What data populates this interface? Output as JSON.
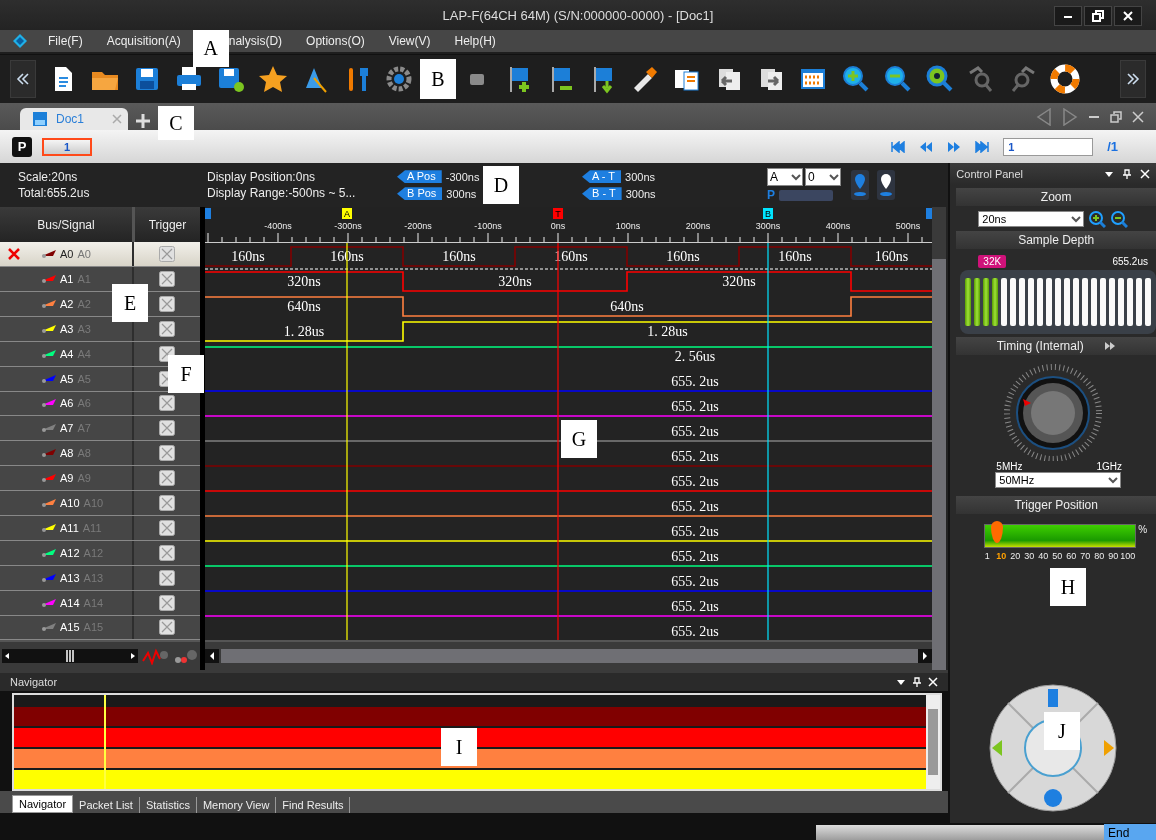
{
  "window": {
    "title": "LAP-F(64CH 64M) (S/N:000000-0000) - [Doc1]"
  },
  "menu": [
    {
      "label": "File(F)"
    },
    {
      "label": "Acquisition(A)"
    },
    {
      "label": "nalysis(D)"
    },
    {
      "label": "Options(O)"
    },
    {
      "label": "View(V)"
    },
    {
      "label": "Help(H)"
    }
  ],
  "doc_tabs": [
    {
      "label": "Doc1",
      "selected": true
    }
  ],
  "page_bar": {
    "p_button": "P",
    "tabs": [
      {
        "label": "1",
        "selected": true
      }
    ],
    "page_input": "1",
    "page_total": "/1"
  },
  "info": {
    "scale": "Scale:20ns",
    "total": "Total:655.2us",
    "display_position": "Display Position:0ns",
    "display_range": "Display Range:-500ns ~ 5...",
    "measurements": [
      {
        "tag": "A Pos",
        "value": "-300ns"
      },
      {
        "tag": "B Pos",
        "value": "300ns"
      },
      {
        "tag": "A - T",
        "value": "300ns"
      },
      {
        "tag": "B - T",
        "value": "300ns"
      }
    ],
    "cursor_select": "A",
    "value_select": "0",
    "p_label": "P"
  },
  "signal_list": {
    "columns": [
      "Bus/Signal",
      "Trigger"
    ],
    "signals": [
      {
        "name": "A0",
        "alias": "A0",
        "color": "#800000",
        "selected": true,
        "labels": [
          "160ns",
          "160ns",
          "160ns",
          "160ns",
          "160ns",
          "160ns",
          "160ns"
        ]
      },
      {
        "name": "A1",
        "alias": "A1",
        "color": "#ff0000",
        "selected": false,
        "labels": [
          "320ns",
          "320ns",
          "320ns"
        ]
      },
      {
        "name": "A2",
        "alias": "A2",
        "color": "#ff8040",
        "selected": false,
        "labels": [
          "640ns",
          "640ns"
        ]
      },
      {
        "name": "A3",
        "alias": "A3",
        "color": "#ffff00",
        "selected": false,
        "labels": [
          "1. 28us",
          "1. 28us"
        ]
      },
      {
        "name": "A4",
        "alias": "A4",
        "color": "#00ff80",
        "selected": false,
        "labels": [
          "2. 56us"
        ]
      },
      {
        "name": "A5",
        "alias": "A5",
        "color": "#0000ff",
        "selected": false,
        "labels": [
          "655. 2us"
        ]
      },
      {
        "name": "A6",
        "alias": "A6",
        "color": "#ff00ff",
        "selected": false,
        "labels": [
          "655. 2us"
        ]
      },
      {
        "name": "A7",
        "alias": "A7",
        "color": "#808080",
        "selected": false,
        "labels": [
          "655. 2us"
        ]
      },
      {
        "name": "A8",
        "alias": "A8",
        "color": "#800000",
        "selected": false,
        "labels": [
          "655. 2us"
        ]
      },
      {
        "name": "A9",
        "alias": "A9",
        "color": "#ff0000",
        "selected": false,
        "labels": [
          "655. 2us"
        ]
      },
      {
        "name": "A10",
        "alias": "A10",
        "color": "#ff8040",
        "selected": false,
        "labels": [
          "655. 2us"
        ]
      },
      {
        "name": "A11",
        "alias": "A11",
        "color": "#ffff00",
        "selected": false,
        "labels": [
          "655. 2us"
        ]
      },
      {
        "name": "A12",
        "alias": "A12",
        "color": "#00ff80",
        "selected": false,
        "labels": [
          "655. 2us"
        ]
      },
      {
        "name": "A13",
        "alias": "A13",
        "color": "#0000ff",
        "selected": false,
        "labels": [
          "655. 2us"
        ]
      },
      {
        "name": "A14",
        "alias": "A14",
        "color": "#ff00ff",
        "selected": false,
        "labels": [
          "655. 2us"
        ]
      },
      {
        "name": "A15",
        "alias": "A15",
        "color": "#808080",
        "selected": false,
        "labels": [
          "655. 2us"
        ]
      }
    ]
  },
  "ruler": {
    "ticks": [
      "-400ns",
      "-300ns",
      "-200ns",
      "-100ns",
      "0ns",
      "100ns",
      "200ns",
      "300ns",
      "400ns",
      "500ns"
    ],
    "cursors": [
      {
        "label": "A",
        "color": "#ffff00"
      },
      {
        "label": "T",
        "color": "#ff0000"
      },
      {
        "label": "B",
        "color": "#00e5ff"
      }
    ]
  },
  "control_panel": {
    "title": "Control Panel",
    "zoom": {
      "title": "Zoom",
      "value": "20ns"
    },
    "sample_depth": {
      "title": "Sample Depth",
      "badge": "32K",
      "duration": "655.2us",
      "level": 0.19
    },
    "timing": {
      "title": "Timing (Internal)",
      "min": "5MHz",
      "max": "1GHz",
      "value": "50MHz"
    },
    "trigger_position": {
      "title": "Trigger Position",
      "unit": "%",
      "level": 0.08,
      "scale": [
        {
          "label": "1",
          "selected": false
        },
        {
          "label": "10",
          "selected": true
        },
        {
          "label": "20",
          "selected": false
        },
        {
          "label": "30",
          "selected": false
        },
        {
          "label": "40",
          "selected": false
        },
        {
          "label": "50",
          "selected": false
        },
        {
          "label": "60",
          "selected": false
        },
        {
          "label": "70",
          "selected": false
        },
        {
          "label": "80",
          "selected": false
        },
        {
          "label": "90",
          "selected": false
        },
        {
          "label": "100",
          "selected": false
        }
      ]
    }
  },
  "navigator": {
    "title": "Navigator",
    "bars": [
      {
        "color": "#800000"
      },
      {
        "color": "#ff0000"
      },
      {
        "color": "#ff8040"
      },
      {
        "color": "#ffff00"
      }
    ],
    "tabs": [
      {
        "label": "Navigator",
        "selected": true
      },
      {
        "label": "Packet List",
        "selected": false
      },
      {
        "label": "Statistics",
        "selected": false
      },
      {
        "label": "Memory View",
        "selected": false
      },
      {
        "label": "Find Results",
        "selected": false
      }
    ]
  },
  "status_bar": {
    "text": "End",
    "level": 0
  },
  "callouts": [
    "A",
    "B",
    "C",
    "D",
    "E",
    "F",
    "G",
    "H",
    "I",
    "J"
  ]
}
